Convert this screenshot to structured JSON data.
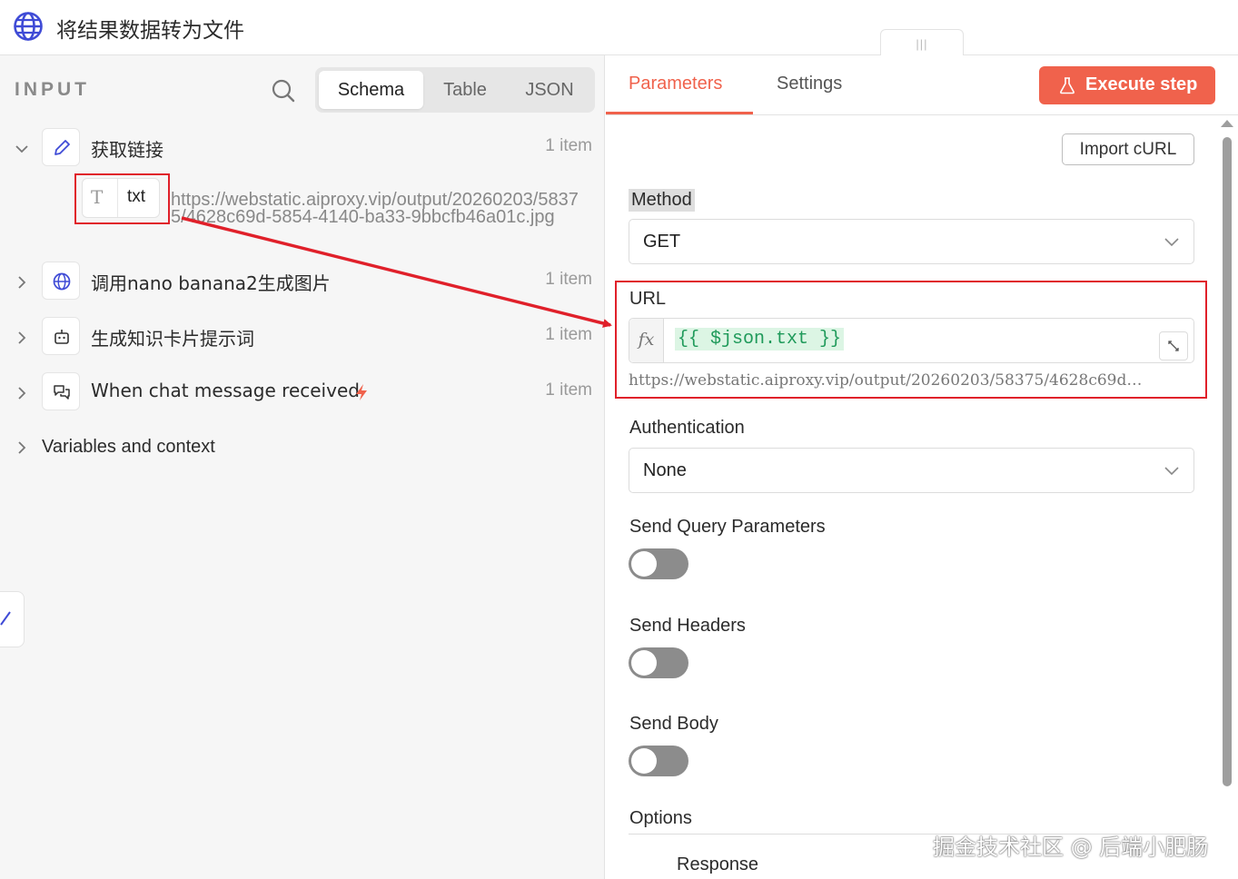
{
  "header": {
    "title": "将结果数据转为文件",
    "drag_handle": "|||"
  },
  "input_panel": {
    "label": "INPUT",
    "tabs": [
      "Schema",
      "Table",
      "JSON"
    ],
    "active_tab": "Schema",
    "nodes": [
      {
        "name": "获取链接",
        "count": "1 item",
        "icon": "pencil-icon",
        "expanded": true
      },
      {
        "name": "调用nano banana2生成图片",
        "count": "1 item",
        "icon": "globe-icon",
        "expanded": false
      },
      {
        "name": "生成知识卡片提示词",
        "count": "1 item",
        "icon": "robot-icon",
        "expanded": false
      },
      {
        "name": "When chat message received",
        "count": "1 item",
        "icon": "chat-icon",
        "expanded": false,
        "trigger_icon": "lightning-icon"
      }
    ],
    "field": {
      "type_icon": "T",
      "name": "txt",
      "value": "https://webstatic.aiproxy.vip/output/20260203/58375/4628c69d-5854-4140-ba33-9bbcfb46a01c.jpg"
    },
    "variables_label": "Variables and context"
  },
  "params_panel": {
    "tabs": [
      "Parameters",
      "Settings"
    ],
    "active_tab": "Parameters",
    "execute_label": "Execute step",
    "import_curl_label": "Import cURL",
    "method_label": "Method",
    "method_value": "GET",
    "url_label": "URL",
    "url_fx": "fx",
    "url_expression": "{{ $json.txt }}",
    "url_resolved": "https://webstatic.aiproxy.vip/output/20260203/58375/4628c69d…",
    "auth_label": "Authentication",
    "auth_value": "None",
    "send_query_label": "Send Query Parameters",
    "send_query_on": false,
    "send_headers_label": "Send Headers",
    "send_headers_on": false,
    "send_body_label": "Send Body",
    "send_body_on": false,
    "options_label": "Options",
    "response_label": "Response"
  },
  "watermark": "掘金技术社区 @ 后端小肥肠",
  "colors": {
    "accent": "#f0624c",
    "annotation_red": "#e0202a",
    "expression_green": "#1f9a5a",
    "expression_bg": "#dcf5e4"
  }
}
